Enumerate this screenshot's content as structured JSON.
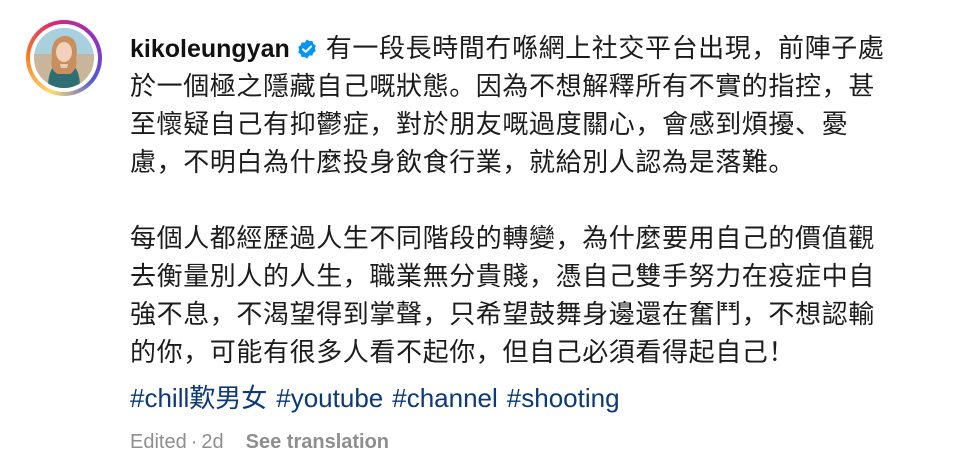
{
  "post": {
    "username": "kikoleungyan",
    "verified_icon": "verified-badge-icon",
    "caption_lines": [
      "有一段長時間冇喺網上社交平台出現，前陣子處",
      "於一個極之隱藏自己嘅狀態。因為不想解釋所有不實的指控，甚",
      "至懷疑自己有抑鬱症，對於朋友嘅過度關心，會感到煩擾、憂",
      "慮，不明白為什麼投身飲食行業，就給別人認為是落難。"
    ],
    "caption_paragraph_2": [
      "每個人都經歷過人生不同階段的轉變，為什麼要用自己的價值觀",
      "去衡量別人的人生，職業無分貴賤，憑自己雙手努力在疫症中自",
      "強不息，不渴望得到掌聲，只希望鼓舞身邊還在奮鬥，不想認輸",
      "的你，可能有很多人看不起你，但自己必須看得起自己！"
    ],
    "hashtags": [
      "#chill歎男女",
      "#youtube",
      "#channel",
      "#shooting"
    ],
    "edited_label": "Edited",
    "separator": "·",
    "time_ago": "2d",
    "see_translation_label": "See translation"
  },
  "colors": {
    "hashtag": "#0b3a76",
    "meta": "#8e8e8e",
    "verified_badge": "#0095f6",
    "text": "#1c1c1c"
  }
}
